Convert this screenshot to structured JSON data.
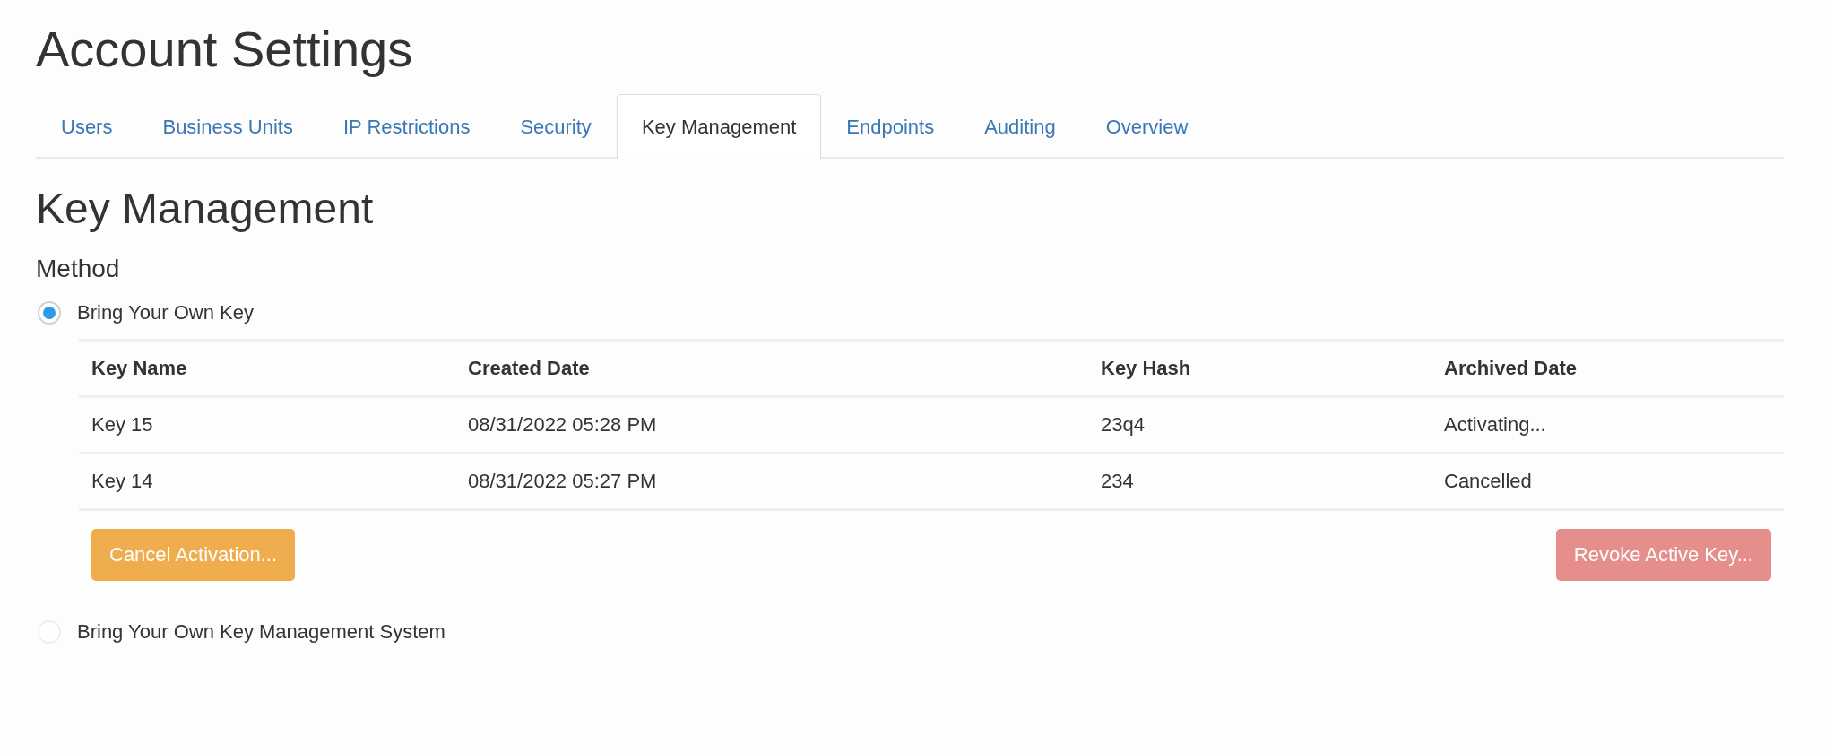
{
  "page": {
    "title": "Account Settings"
  },
  "tabs": [
    {
      "label": "Users",
      "selected": false
    },
    {
      "label": "Business Units",
      "selected": false
    },
    {
      "label": "IP Restrictions",
      "selected": false
    },
    {
      "label": "Security",
      "selected": false
    },
    {
      "label": "Key Management",
      "selected": true
    },
    {
      "label": "Endpoints",
      "selected": false
    },
    {
      "label": "Auditing",
      "selected": false
    },
    {
      "label": "Overview",
      "selected": false
    }
  ],
  "section": {
    "title": "Key Management",
    "subtitle": "Method"
  },
  "methods": [
    {
      "label": "Bring Your Own Key",
      "selected": true,
      "table": {
        "columns": [
          "Key Name",
          "Created Date",
          "Key Hash",
          "Archived Date"
        ],
        "rows": [
          [
            "Key 15",
            "08/31/2022 05:28 PM",
            "23q4",
            "Activating..."
          ],
          [
            "Key 14",
            "08/31/2022 05:27 PM",
            "234",
            "Cancelled"
          ]
        ]
      },
      "buttons": [
        {
          "label": "Cancel Activation...",
          "kind": "warning",
          "disabled": false
        },
        {
          "label": "Revoke Active Key...",
          "kind": "danger",
          "disabled": true
        }
      ]
    },
    {
      "label": "Bring Your Own Key Management System",
      "selected": false
    }
  ]
}
